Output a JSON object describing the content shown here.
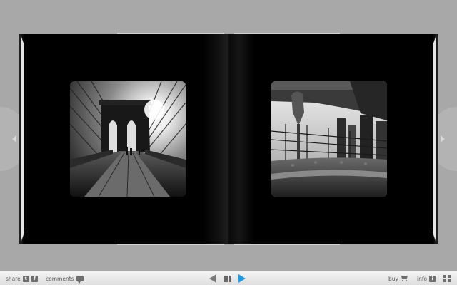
{
  "toolbar": {
    "share_label": "share",
    "twitter_glyph": "t",
    "facebook_glyph": "f",
    "comments_label": "comments",
    "buy_label": "buy",
    "info_label": "info",
    "info_glyph": "i"
  },
  "icons": {
    "prev": "triangle-left",
    "next": "triangle-right",
    "grid": "grid",
    "cart": "shopping-cart",
    "fullscreen": "expand",
    "comment": "speech-bubble"
  },
  "colors": {
    "background": "#a8a8a8",
    "book_cover": "#000000",
    "next_accent": "#1d9be6",
    "toolbar_bg": "#e8e8e8"
  }
}
